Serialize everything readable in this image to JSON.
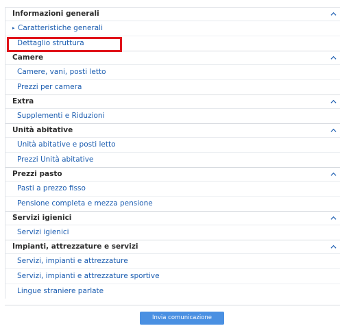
{
  "sections": [
    {
      "title": "Informazioni generali",
      "items": [
        "Caratteristiche generali",
        "Dettaglio struttura"
      ]
    },
    {
      "title": "Camere",
      "items": [
        "Camere, vani, posti letto",
        "Prezzi per camera"
      ]
    },
    {
      "title": "Extra",
      "items": [
        "Supplementi e Riduzioni"
      ]
    },
    {
      "title": "Unità abitative",
      "items": [
        "Unità abitative e posti letto",
        "Prezzi Unità abitative"
      ]
    },
    {
      "title": "Prezzi pasto",
      "items": [
        "Pasti a prezzo fisso",
        "Pensione completa e mezza pensione"
      ]
    },
    {
      "title": "Servizi igienici",
      "items": [
        "Servizi igienici"
      ]
    },
    {
      "title": "Impianti, attrezzature e servizi",
      "items": [
        "Servizi, impianti e attrezzature",
        "Servizi, impianti e attrezzature sportive",
        "Lingue straniere parlate"
      ]
    }
  ],
  "active_item_marker": "▸",
  "footer": {
    "send_label": "Invia comunicazione"
  },
  "colors": {
    "link": "#1a5cb0",
    "highlight": "#e0141b",
    "button": "#4a90e2"
  },
  "icons": {
    "section_toggle": "chevron-up-icon"
  }
}
